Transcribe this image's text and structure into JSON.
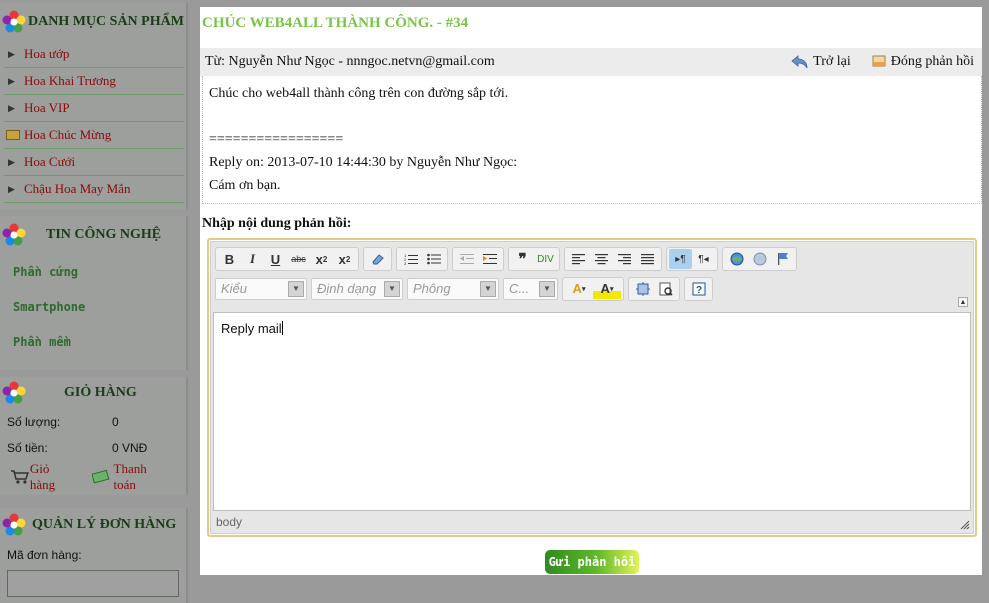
{
  "sidebar": {
    "categories": {
      "title": "DANH MỤC SẢN PHẨM",
      "items": [
        {
          "label": "Hoa ướp"
        },
        {
          "label": "Hoa Khai Trương"
        },
        {
          "label": "Hoa VIP"
        },
        {
          "label": "Hoa Chúc Mừng"
        },
        {
          "label": "Hoa Cưới"
        },
        {
          "label": "Chậu Hoa May Mắn"
        }
      ]
    },
    "tech": {
      "title": "TIN CÔNG NGHỆ",
      "items": [
        {
          "label": "Phần cứng"
        },
        {
          "label": "Smartphone"
        },
        {
          "label": "Phần mềm"
        }
      ]
    },
    "cart": {
      "title": "GIỎ HÀNG",
      "quantity_label": "Số lượng:",
      "quantity_value": "0",
      "amount_label": "Số tiền:",
      "amount_value": "0 VNĐ",
      "cart_link": "Giỏ hàng",
      "checkout_link": "Thanh toán"
    },
    "orders": {
      "title": "QUẢN LÝ ĐƠN HÀNG",
      "order_code_label": "Mã đơn hàng:",
      "order_code_value": ""
    }
  },
  "main": {
    "title": "CHÚC WEB4ALL THÀNH CÔNG. - #34",
    "from_line": "Từ: Nguyễn Như Ngọc - nnngoc.netvn@gmail.com",
    "back_label": "Trở lại",
    "close_label": "Đóng phản hồi",
    "message": {
      "line1": "Chúc cho web4all thành công trên con đường sắp tới.",
      "separator": "=================",
      "reply_meta": "Reply on: 2013-07-10 14:44:30 by Nguyễn Như Ngọc:",
      "reply_text": "Cám ơn bạn."
    },
    "reply_label": "Nhập nội dung phản hồi:",
    "editor": {
      "format_placeholder": "Kiểu",
      "block_placeholder": "Định dạng",
      "font_placeholder": "Phông",
      "size_placeholder": "C...",
      "content": "Reply mail",
      "status_path": "body"
    },
    "send_label": "Gửi phản hồi"
  },
  "colors": {
    "title_green": "#78c44a",
    "link_red": "#8b0a0a",
    "tech_green": "#2d6a2d",
    "editor_border": "#e7c884"
  }
}
